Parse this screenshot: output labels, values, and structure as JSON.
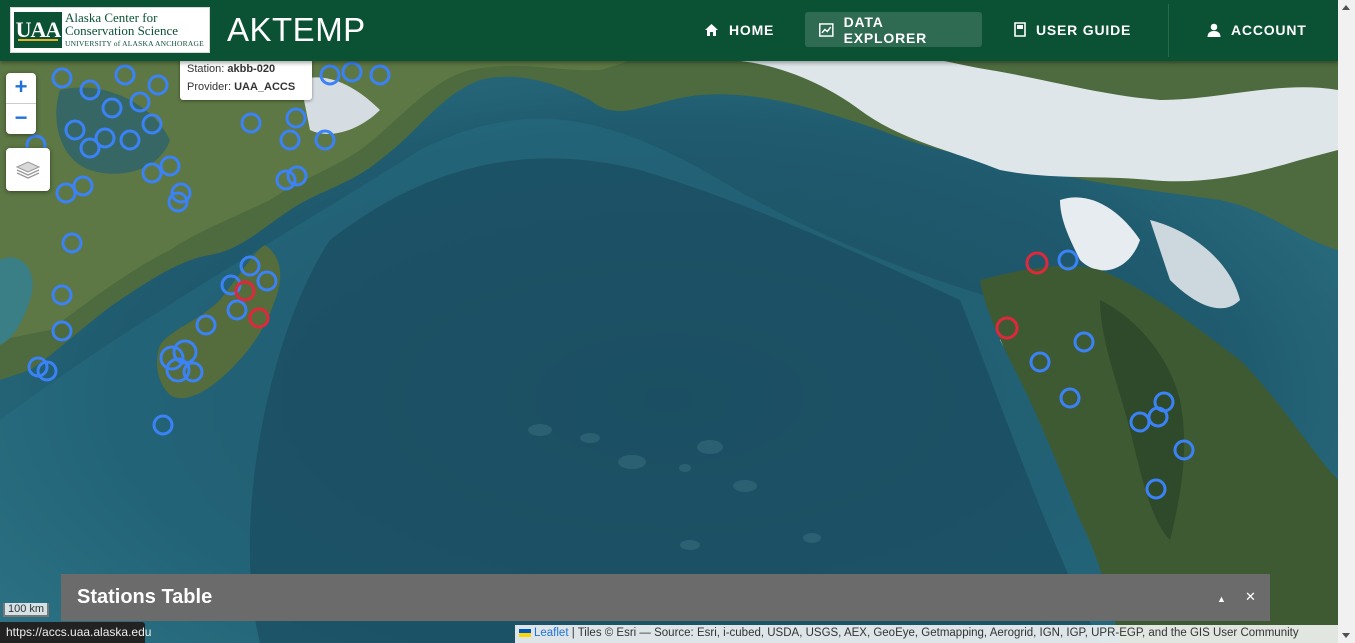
{
  "header": {
    "logo": {
      "line1": "Alaska Center for",
      "line2": "Conservation Science",
      "line3": "UNIVERSITY of ALASKA ANCHORAGE",
      "mark": "UAA"
    },
    "title": "AKTEMP",
    "nav": [
      {
        "label": "HOME",
        "icon": "home-icon",
        "active": false
      },
      {
        "label": "DATA EXPLORER",
        "icon": "chart-icon",
        "active": true
      },
      {
        "label": "USER GUIDE",
        "icon": "book-icon",
        "active": false
      },
      {
        "label": "ACCOUNT",
        "icon": "user-icon",
        "active": false
      }
    ]
  },
  "map": {
    "zoom_in": "+",
    "zoom_out": "−",
    "layers_icon": "layers-icon",
    "tooltip": {
      "station_label": "Station:",
      "station": "akbb-020",
      "provider_label": "Provider:",
      "provider": "UAA_ACCS"
    },
    "scale": "100 km",
    "attribution": {
      "link": "Leaflet",
      "text": "| Tiles © Esri — Source: Esri, i-cubed, USDA, USGS, AEX, GeoEye, Getmapping, Aerogrid, IGN, IGP, UPR-EGP, and the GIS User Community"
    },
    "marker_colors": {
      "station": "#3b82f6",
      "selected": "#e0283c"
    }
  },
  "stations_table": {
    "title": "Stations Table",
    "collapse_icon": "▲",
    "close_icon": "✕"
  },
  "status_url": "https://accs.uaa.alaska.edu"
}
